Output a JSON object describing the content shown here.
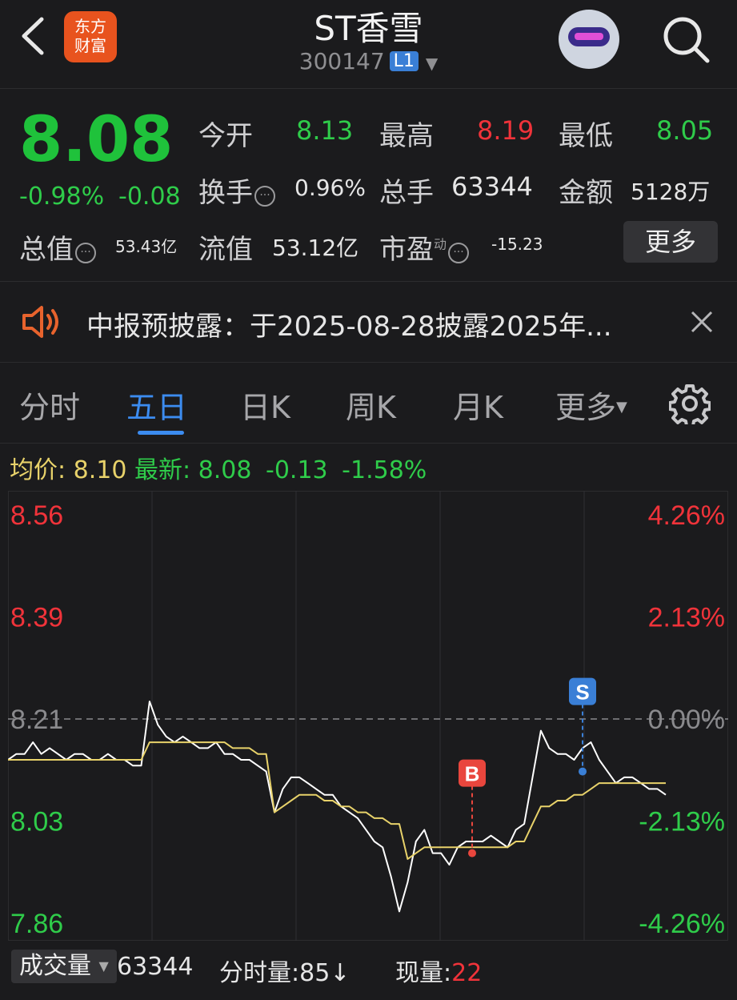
{
  "header": {
    "title": "ST香雪",
    "code": "300147",
    "level": "L1",
    "logo_text_1": "东方",
    "logo_text_2": "财富"
  },
  "quote": {
    "price": "8.08",
    "change_pct": "-0.98%",
    "change": "-0.08",
    "open_label": "今开",
    "open": "8.13",
    "high_label": "最高",
    "high": "8.19",
    "low_label": "最低",
    "low": "8.05",
    "turnover_label": "换手",
    "turnover": "0.96%",
    "volume_label": "总手",
    "volume": "63344",
    "amount_label": "金额",
    "amount": "5128万",
    "mktcap_label": "总值",
    "mktcap": "53.43亿",
    "float_label": "流值",
    "float_cap": "53.12亿",
    "pe_label": "市盈",
    "pe_super": "动",
    "pe": "-15.23",
    "more_button": "更多"
  },
  "notice": {
    "text": "中报预披露：于2025-08-28披露2025年..."
  },
  "tabs": [
    "分时",
    "五日",
    "日K",
    "周K",
    "月K",
    "更多"
  ],
  "active_tab": "五日",
  "info_line": {
    "avg_label": "均价:",
    "avg": "8.10",
    "latest_label": "最新:",
    "latest": "8.08",
    "chg": "-0.13",
    "chg_pct": "-1.58%"
  },
  "chart_data": {
    "type": "line",
    "y_left_ticks": [
      "8.56",
      "8.39",
      "8.21",
      "8.03",
      "7.86"
    ],
    "y_right_ticks": [
      "4.26%",
      "2.13%",
      "0.00%",
      "-2.13%",
      "-4.26%"
    ],
    "ylim": [
      7.86,
      8.56
    ],
    "reference": 8.21,
    "days": 5,
    "series": [
      {
        "values": [
          8.14,
          8.15,
          8.15,
          8.17,
          8.15,
          8.16,
          8.15,
          8.14,
          8.15,
          8.15,
          8.14,
          8.14,
          8.15,
          8.14,
          8.14,
          8.13,
          8.13,
          8.24,
          8.2,
          8.18,
          8.17,
          8.18,
          8.17,
          8.16,
          8.16,
          8.17,
          8.15,
          8.15,
          8.14,
          8.14,
          8.13,
          8.12,
          8.05,
          8.09,
          8.11,
          8.11,
          8.1,
          8.09,
          8.08,
          8.08,
          8.06,
          8.05,
          8.04,
          8.02,
          8.0,
          7.99,
          7.94,
          7.88,
          7.93,
          8.0,
          8.02,
          7.98,
          7.98,
          7.96,
          7.99,
          8.0,
          8.0,
          8.0,
          8.01,
          8.0,
          7.99,
          8.02,
          8.03,
          8.11,
          8.19,
          8.16,
          8.15,
          8.15,
          8.14,
          8.16,
          8.17,
          8.14,
          8.12,
          8.1,
          8.11,
          8.11,
          8.1,
          8.09,
          8.09,
          8.08
        ]
      },
      {
        "values": [
          8.14,
          8.14,
          8.14,
          8.14,
          8.14,
          8.14,
          8.14,
          8.14,
          8.14,
          8.14,
          8.14,
          8.14,
          8.14,
          8.14,
          8.14,
          8.14,
          8.14,
          8.17,
          8.17,
          8.17,
          8.17,
          8.17,
          8.17,
          8.17,
          8.17,
          8.17,
          8.17,
          8.16,
          8.16,
          8.16,
          8.15,
          8.15,
          8.05,
          8.06,
          8.07,
          8.08,
          8.08,
          8.08,
          8.07,
          8.07,
          8.06,
          8.06,
          8.05,
          8.05,
          8.04,
          8.04,
          8.03,
          8.03,
          7.97,
          7.98,
          7.99,
          7.99,
          7.99,
          7.99,
          7.99,
          7.99,
          7.99,
          7.99,
          7.99,
          7.99,
          7.99,
          8.0,
          8.0,
          8.03,
          8.06,
          8.06,
          8.07,
          8.07,
          8.08,
          8.08,
          8.09,
          8.1,
          8.1,
          8.1,
          8.1,
          8.1,
          8.1,
          8.1,
          8.1,
          8.1
        ]
      }
    ],
    "markers": [
      {
        "label": "B",
        "value": 7.98
      },
      {
        "label": "S",
        "value": 8.12
      }
    ],
    "colors": {
      "price": "#ffffff",
      "avg": "#e8d26a",
      "up": "#f0333a",
      "down": "#2fcc4a",
      "marker_b": "#e9463d",
      "marker_s": "#3a7fd6"
    }
  },
  "footer": {
    "volume_select": "成交量",
    "volume_total": "63344",
    "tick_label": "分时量:",
    "tick_value": "85↓",
    "now_label": "现量:",
    "now_value": "22"
  }
}
